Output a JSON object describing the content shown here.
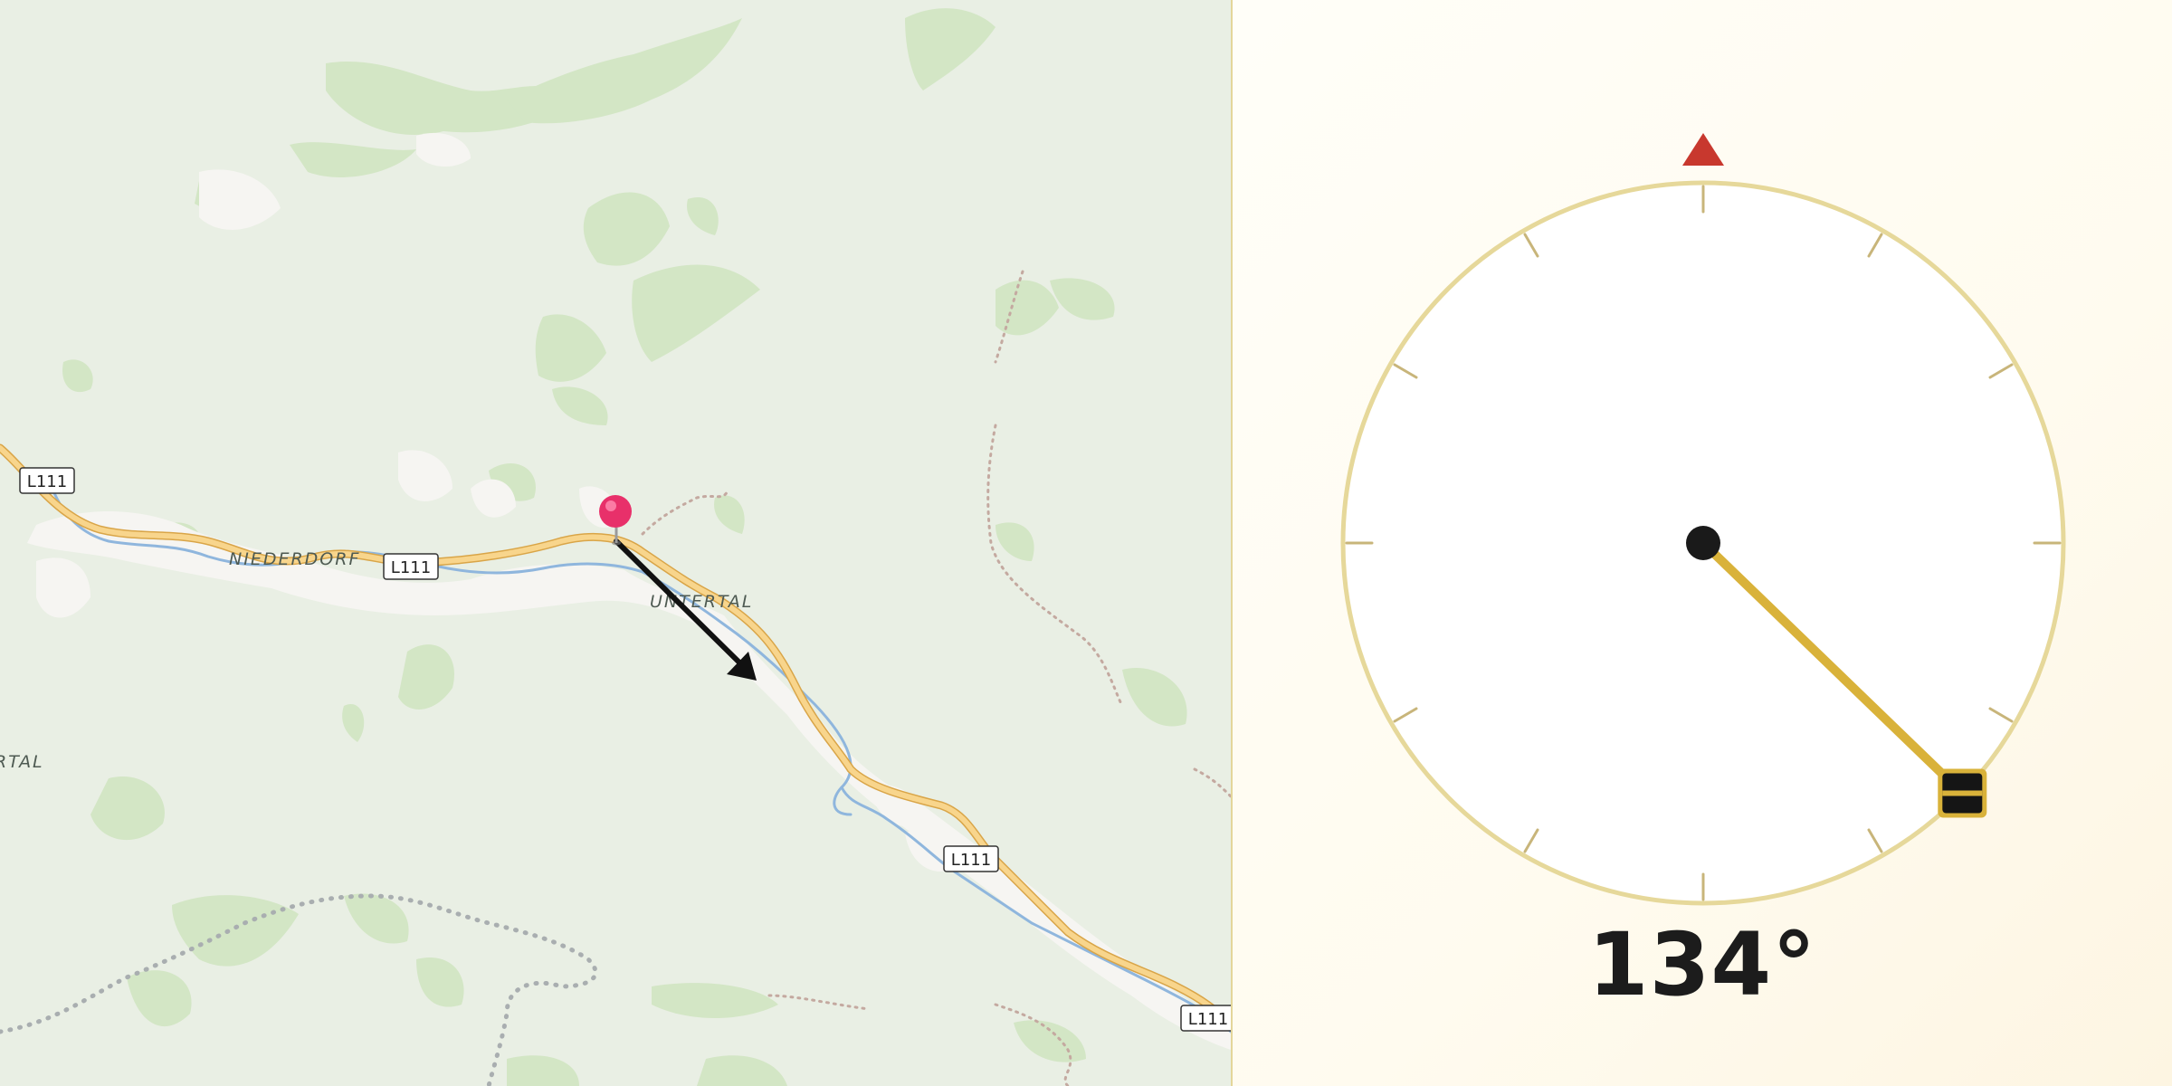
{
  "map": {
    "place_labels": {
      "niederdorf": "NIEDERDORF",
      "untertal": "UNTERTAL",
      "left_edge": "RTAL"
    },
    "road_ref": "L111",
    "pin_color": "#e8306a",
    "road_color": "#f2c46e",
    "river_color": "#8fb6dd",
    "forest_color": "#cfe3c0",
    "land_color": "#e9efe4",
    "settlement_color": "#f7f6f3",
    "heading_arrow_color": "#111111"
  },
  "compass": {
    "heading_deg": 134,
    "heading_text": "134",
    "degree_symbol": "°",
    "north_marker_color": "#c8382e",
    "ring_color": "#e6d89a",
    "needle_color": "#d9b23a",
    "hub_color": "#1a1a1a",
    "tick_color": "#c8b57a",
    "handle_icon": "drag-handle-icon"
  }
}
